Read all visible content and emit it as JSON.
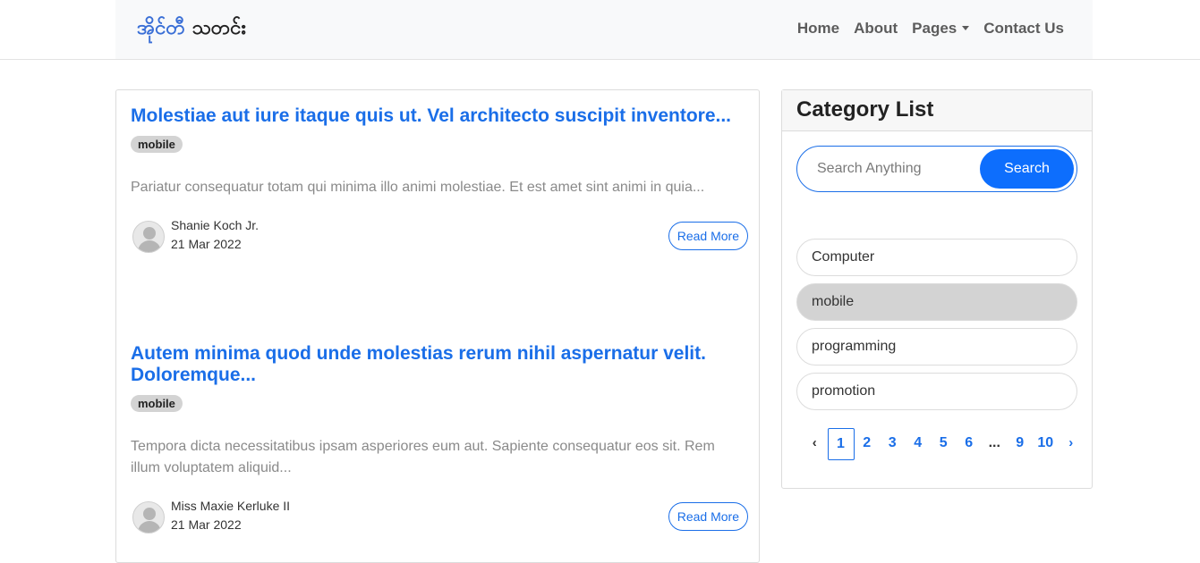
{
  "brand": {
    "part1": "အိုင်တီ",
    "part2": "သတင်း"
  },
  "nav": {
    "home": "Home",
    "about": "About",
    "pages": "Pages",
    "contact": "Contact Us"
  },
  "posts": [
    {
      "title": "Molestiae aut iure itaque quis ut. Vel architecto suscipit inventore...",
      "tag": "mobile",
      "excerpt": "Pariatur consequatur totam qui minima illo animi molestiae. Et est amet sint animi in quia...",
      "author": "Shanie Koch Jr.",
      "date": "21 Mar 2022",
      "read_more": "Read More"
    },
    {
      "title": "Autem minima quod unde molestias rerum nihil aspernatur velit. Doloremque...",
      "tag": "mobile",
      "excerpt": "Tempora dicta necessitatibus ipsam asperiores eum aut. Sapiente consequatur eos sit. Rem illum voluptatem aliquid...",
      "author": "Miss Maxie Kerluke II",
      "date": "21 Mar 2022",
      "read_more": "Read More"
    }
  ],
  "sidebar": {
    "title": "Category List",
    "search_placeholder": "Search Anything",
    "search_button": "Search",
    "categories": [
      "Computer",
      "mobile",
      "programming",
      "promotion"
    ],
    "active_category": "mobile"
  },
  "pagination": {
    "prev": "‹",
    "pages": [
      "1",
      "2",
      "3",
      "4",
      "5",
      "6",
      "...",
      "9",
      "10"
    ],
    "next": "›",
    "current": "1"
  }
}
